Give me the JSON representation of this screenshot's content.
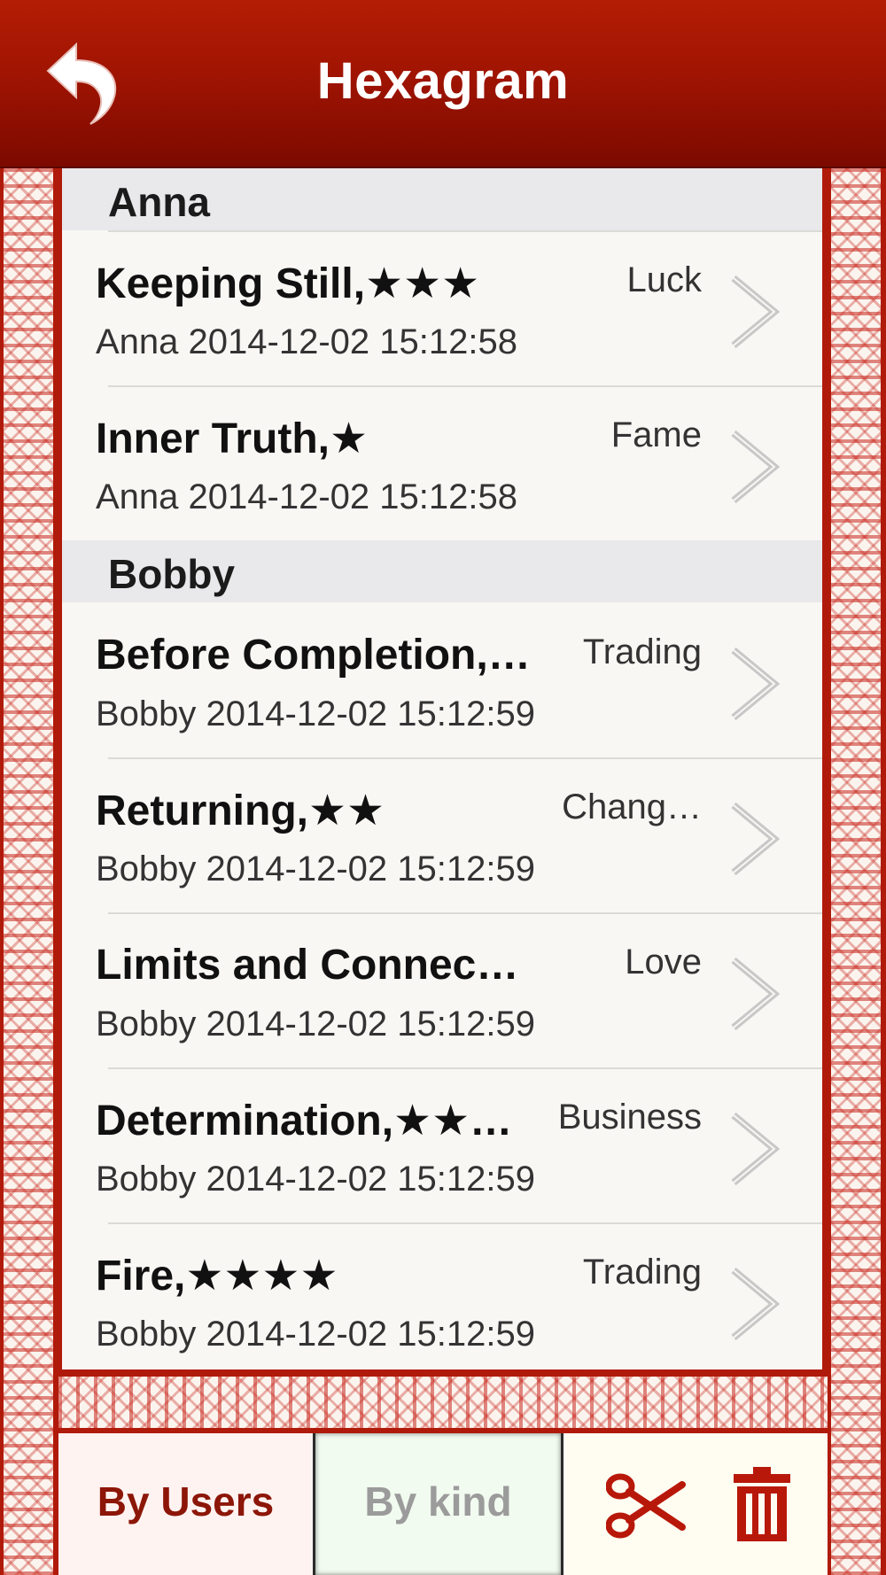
{
  "header": {
    "title": "Hexagram",
    "back_icon": "back-arrow-icon"
  },
  "sections": [
    {
      "name": "Anna",
      "rows": [
        {
          "title": "Keeping Still,★★★",
          "subtitle": "Anna 2014-12-02 15:12:58",
          "kind": "Luck"
        },
        {
          "title": "Inner Truth,★",
          "subtitle": "Anna 2014-12-02 15:12:58",
          "kind": "Fame"
        }
      ]
    },
    {
      "name": "Bobby",
      "rows": [
        {
          "title": "Before Completion,…",
          "subtitle": "Bobby 2014-12-02 15:12:59",
          "kind": "Trading"
        },
        {
          "title": "Returning,★★",
          "subtitle": "Bobby 2014-12-02 15:12:59",
          "kind": "Chang…"
        },
        {
          "title": "Limits and Connec…",
          "subtitle": "Bobby 2014-12-02 15:12:59",
          "kind": "Love"
        },
        {
          "title": "Determination,★★…",
          "subtitle": "Bobby 2014-12-02 15:12:59",
          "kind": "Business"
        },
        {
          "title": "Fire,★★★★",
          "subtitle": "Bobby 2014-12-02 15:12:59",
          "kind": "Trading"
        }
      ]
    }
  ],
  "toolbar": {
    "by_users_label": "By Users",
    "by_kind_label": "By kind",
    "scissors_icon": "scissors-icon",
    "trash_icon": "trash-icon"
  },
  "colors": {
    "header_red": "#a01402",
    "frame_red": "#b01a0a",
    "active_tab_text": "#8c1608",
    "inactive_tab_text": "#9b9b9b"
  }
}
